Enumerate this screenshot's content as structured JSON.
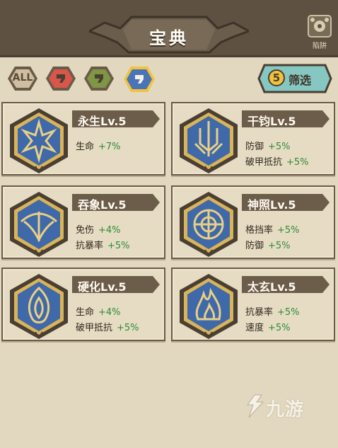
{
  "header": {
    "title": "宝典",
    "corner_label": "陷阱"
  },
  "filters": [
    {
      "label": "ALL",
      "color": "#cfbfa0",
      "selected": false
    },
    {
      "label": "",
      "color": "#d9564a",
      "selected": false
    },
    {
      "label": "",
      "color": "#7f9645",
      "selected": false
    },
    {
      "label": "",
      "color": "#4a74b8",
      "selected": true
    }
  ],
  "screen": {
    "count": "5",
    "label": "筛选",
    "color": "#86c7c2"
  },
  "cards": [
    {
      "name": "永生Lv.5",
      "stats": [
        {
          "label": "生命",
          "value": "+7%"
        }
      ]
    },
    {
      "name": "干钧Lv.5",
      "stats": [
        {
          "label": "防御",
          "value": "+5%"
        },
        {
          "label": "破甲抵抗",
          "value": "+5%"
        }
      ]
    },
    {
      "name": "吞象Lv.5",
      "stats": [
        {
          "label": "免伤",
          "value": "+4%"
        },
        {
          "label": "抗暴率",
          "value": "+5%"
        }
      ]
    },
    {
      "name": "神照Lv.5",
      "stats": [
        {
          "label": "格挡率",
          "value": "+5%"
        },
        {
          "label": "防御",
          "value": "+5%"
        }
      ]
    },
    {
      "name": "硬化Lv.5",
      "stats": [
        {
          "label": "生命",
          "value": "+4%"
        },
        {
          "label": "破甲抵抗",
          "value": "+5%"
        }
      ]
    },
    {
      "name": "太玄Lv.5",
      "stats": [
        {
          "label": "抗暴率",
          "value": "+5%"
        },
        {
          "label": "速度",
          "value": "+5%"
        }
      ]
    }
  ],
  "emblems": [
    "star-crest-icon",
    "trident-crest-icon",
    "wing-crest-icon",
    "flower-crest-icon",
    "flame-crest-icon",
    "blaze-crest-icon"
  ],
  "watermark": {
    "text": "九游"
  },
  "colors": {
    "header": "#5e5141",
    "paper": "#e2d8bf",
    "emblem_blue": "#3f69a8",
    "emblem_gold": "#d9b45a",
    "stat_green": "#2f8a3a"
  }
}
